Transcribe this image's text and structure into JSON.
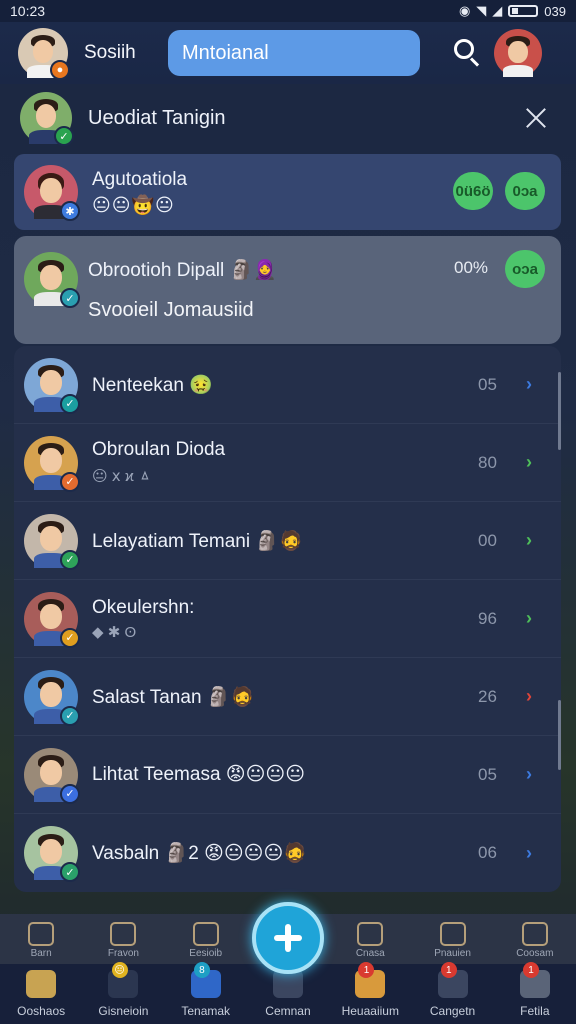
{
  "status_bar": {
    "time": "10:23",
    "battery": "039"
  },
  "top_bar": {
    "title": "Sosiih",
    "search_value": "Mntoianal",
    "icons": [
      "search-icon",
      "profile-avatar"
    ]
  },
  "panel": {
    "header": "Ueodiat Tanigin",
    "close_icon": "close-icon"
  },
  "featured": {
    "name": "Agutoatiola",
    "emoji": "😐😐🤠😐",
    "pill_a": "0ü6ö",
    "pill_b": "0ɔa"
  },
  "selected": {
    "name": "Obrootioh Dipall 🗿🧕",
    "sub": "Svooieil Jomausiid",
    "pct": "00%",
    "pill": "oɔa"
  },
  "list": [
    {
      "name": "Nenteekan 🤢",
      "sub": "",
      "count": "05",
      "chevron_color": "#3d7be0",
      "avatar_color": "#7ea7d6",
      "badge": "#1b9fa0"
    },
    {
      "name": "Obroulan Dioda",
      "sub": "😐 ⅹ ϰ ㅿ",
      "count": "80",
      "chevron_color": "#4fc05a",
      "avatar_color": "#d6a24f",
      "badge": "#e46b2f"
    },
    {
      "name": "Lelayatiam Temani 🗿🧔",
      "sub": "",
      "count": "00",
      "chevron_color": "#4fc05a",
      "avatar_color": "#c3b7aa",
      "badge": "#2ea35a"
    },
    {
      "name": "Okeulershn:",
      "sub": "◆ ✱ ʘ",
      "count": "96",
      "chevron_color": "#4fc05a",
      "avatar_color": "#a85d5a",
      "badge": "#e09e1f"
    },
    {
      "name": "Salast Tanan 🗿🧔",
      "sub": "",
      "count": "26",
      "chevron_color": "#e0453a",
      "avatar_color": "#4c87c9",
      "badge": "#2a9fb0"
    },
    {
      "name": "Lihtat Teemasa 😡😐😐😐",
      "sub": "",
      "count": "05",
      "chevron_color": "#3d7be0",
      "avatar_color": "#9a8a78",
      "badge": "#3c6fe0"
    },
    {
      "name": "Vasbaln 🗿2 😡😐😐😐🧔",
      "sub": "",
      "count": "06",
      "chevron_color": "#3d7be0",
      "avatar_color": "#a6c3a0",
      "badge": "#2aa06a"
    }
  ],
  "nav_peek": [
    "Barn",
    "Fravon",
    "Eesioib",
    "",
    "Cnasa",
    "Pnauien",
    "Coosam"
  ],
  "nav": [
    {
      "label": "Ooshaos",
      "icon": "home-icon",
      "color": "#c8a352",
      "notif": ""
    },
    {
      "label": "Gisneioin",
      "icon": "chart-icon",
      "color": "#2b3650",
      "notif": "😐"
    },
    {
      "label": "Tenamak",
      "icon": "folder-icon",
      "color": "#2f67c8",
      "notif": "8"
    },
    {
      "label": "Cemnan",
      "icon": "clock-icon",
      "color": "#3b4660",
      "notif": ""
    },
    {
      "label": "Heuaaiium",
      "icon": "camera-icon",
      "color": "#d89a3c",
      "notif": "1"
    },
    {
      "label": "Cangetn",
      "icon": "timer-icon",
      "color": "#3b4660",
      "notif": "1"
    },
    {
      "label": "Fetila",
      "icon": "chat-icon",
      "color": "#5a6478",
      "notif": "1"
    }
  ],
  "colors": {
    "accent": "#5d9ae6",
    "pill_green": "#4cc56b",
    "fab": "#1fa4d8"
  }
}
